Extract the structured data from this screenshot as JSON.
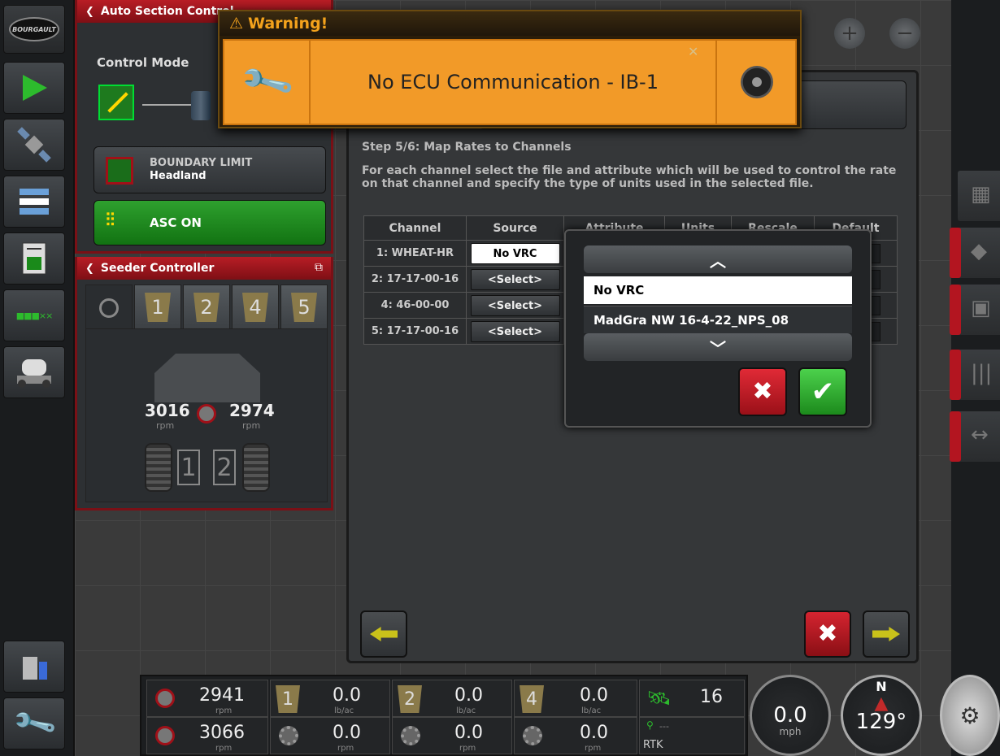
{
  "colors": {
    "accent_red": "#b81d25",
    "warning_orange": "#f29a28",
    "asc_green": "#2ea02e"
  },
  "sidebar_left": {
    "logo_text": "BOURGAULT",
    "icons": [
      "play-triangle-icon",
      "satellite-icon",
      "list-icon",
      "report-icon",
      "sections-icon",
      "seeder-icon",
      "trash-icon",
      "wrench-icon"
    ],
    "sections_label": "■■■××"
  },
  "sidebar_right": {
    "icons": [
      "map-icon",
      "eraser-icon",
      "map-layers-icon",
      "guide-lines-icon",
      "nudge-icon"
    ]
  },
  "auto_section": {
    "header": "Auto Section Control",
    "control_mode_label": "Control Mode",
    "boundary_title": "BOUNDARY LIMIT",
    "boundary_value": "Headland",
    "asc_label": "ASC ON"
  },
  "seeder": {
    "header": "Seeder Controller",
    "tabs": [
      "1",
      "2",
      "4",
      "5"
    ],
    "rpm_left": "3016",
    "rpm_right": "2974",
    "rpm_unit": "rpm",
    "meters": [
      "1",
      "2"
    ]
  },
  "warning": {
    "title": "Warning!",
    "message": "No ECU Communication - IB-1"
  },
  "wizard": {
    "step_title": "Step 5/6: Map Rates to Channels",
    "step_desc": "For each channel select the file and attribute which will be used to control the rate on that channel and specify the type of units used in the selected file.",
    "columns": [
      "Channel",
      "Source",
      "Attribute",
      "Units",
      "Rescale",
      "Default"
    ],
    "rows": [
      {
        "channel": "1: WHEAT-HR",
        "source": "No VRC"
      },
      {
        "channel": "2: 17-17-00-16",
        "source": "<Select>"
      },
      {
        "channel": "4: 46-00-00",
        "source": "<Select>"
      },
      {
        "channel": "5: 17-17-00-16",
        "source": "<Select>"
      }
    ]
  },
  "dropdown": {
    "options": [
      "No VRC",
      "MadGra NW 16-4-22_NPS_08"
    ],
    "selected": "No VRC"
  },
  "status_bar": {
    "fan1_rpm": "2941",
    "fan2_rpm": "3066",
    "rpm_unit": "rpm",
    "rate_unit": "lb/ac",
    "tanks": [
      {
        "num": "1",
        "rate": "0.0",
        "meter_rpm": "0.0"
      },
      {
        "num": "2",
        "rate": "0.0",
        "meter_rpm": "0.0"
      },
      {
        "num": "4",
        "rate": "0.0",
        "meter_rpm": "0.0"
      }
    ],
    "gps_sats": "16",
    "gps_age": "---",
    "gps_mode": "RTK",
    "speed": "0.0",
    "speed_unit": "mph",
    "heading": "129°",
    "compass_n": "N"
  }
}
